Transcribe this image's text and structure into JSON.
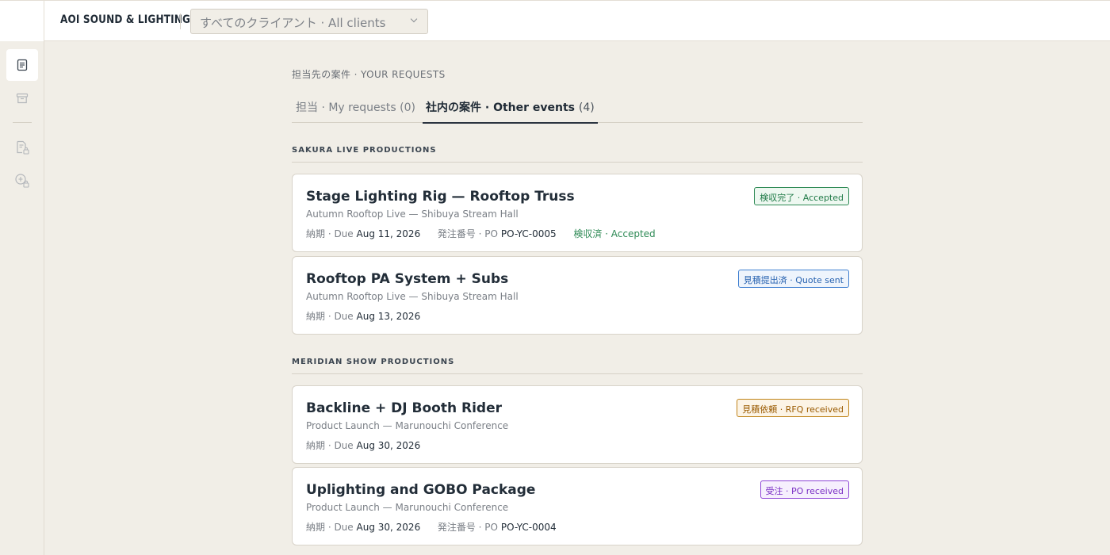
{
  "app": {
    "brand": "AOI SOUND & LIGHTING",
    "client_select": {
      "value": "すべてのクライアント · All clients"
    }
  },
  "sidebar": {
    "items": [
      {
        "icon": "document-icon",
        "active": true
      },
      {
        "icon": "archive-icon",
        "active": false
      },
      {
        "icon": "file-lock-icon",
        "active": false
      },
      {
        "icon": "money-lock-icon",
        "active": false
      }
    ]
  },
  "main": {
    "kicker": "担当先の案件 · YOUR REQUESTS",
    "tabs": [
      {
        "label": "担当 · My requests",
        "count": "(0)"
      },
      {
        "label": "社内の案件 · Other events",
        "count": "(4)"
      }
    ],
    "groups": [
      {
        "title": "SAKURA LIVE PRODUCTIONS",
        "cards": [
          {
            "title": "Stage Lighting Rig — Rooftop Truss",
            "subtitle": "Autumn Rooftop Live — Shibuya Stream Hall",
            "due_label": "納期 · Due",
            "due": "Aug 11, 2026",
            "po_label": "発注番号 · PO",
            "po": "PO-YC-0005",
            "status_text": "検収済 · Accepted",
            "badge": "検収完了 · Accepted"
          },
          {
            "title": "Rooftop PA System + Subs",
            "subtitle": "Autumn Rooftop Live — Shibuya Stream Hall",
            "due_label": "納期 · Due",
            "due": "Aug 13, 2026",
            "badge": "見積提出済 · Quote sent"
          }
        ]
      },
      {
        "title": "MERIDIAN SHOW PRODUCTIONS",
        "cards": [
          {
            "title": "Backline + DJ Booth Rider",
            "subtitle": "Product Launch — Marunouchi Conference",
            "due_label": "納期 · Due",
            "due": "Aug 30, 2026",
            "badge": "見積依頼 · RFQ received"
          },
          {
            "title": "Uplighting and GOBO Package",
            "subtitle": "Product Launch — Marunouchi Conference",
            "due_label": "納期 · Due",
            "due": "Aug 30, 2026",
            "po_label": "発注番号 · PO",
            "po": "PO-YC-0004",
            "badge": "受注 · PO received"
          }
        ]
      }
    ]
  },
  "colors": {
    "background": "#f1eee7",
    "accepted_green": "#2e8a55",
    "quote_blue": "#3f7fd0",
    "rfq_orange": "#c0841a",
    "po_purple": "#8e45d6"
  }
}
